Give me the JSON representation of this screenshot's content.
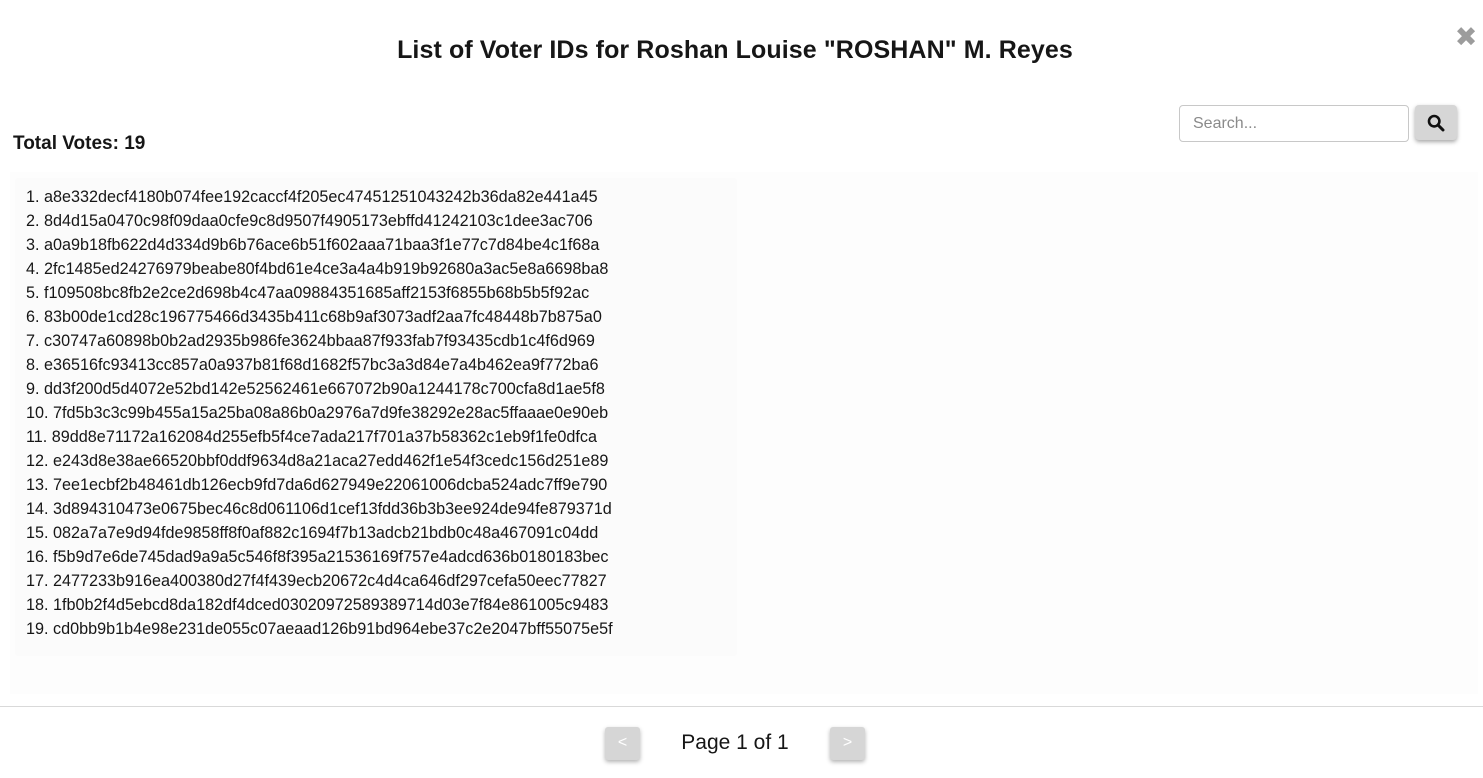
{
  "modal": {
    "title": "List of Voter IDs for Roshan Louise \"ROSHAN\" M. Reyes",
    "close_icon": "close-x-icon",
    "close_glyph": "✖"
  },
  "search": {
    "placeholder": "Search...",
    "value": "",
    "button_icon": "search-icon"
  },
  "summary": {
    "total_votes_label": "Total Votes: 19"
  },
  "voter_ids": [
    "1. a8e332decf4180b074fee192caccf4f205ec47451251043242b36da82e441a45",
    "2. 8d4d15a0470c98f09daa0cfe9c8d9507f4905173ebffd41242103c1dee3ac706",
    "3. a0a9b18fb622d4d334d9b6b76ace6b51f602aaa71baa3f1e77c7d84be4c1f68a",
    "4. 2fc1485ed24276979beabe80f4bd61e4ce3a4a4b919b92680a3ac5e8a6698ba8",
    "5. f109508bc8fb2e2ce2d698b4c47aa09884351685aff2153f6855b68b5b5f92ac",
    "6. 83b00de1cd28c196775466d3435b411c68b9af3073adf2aa7fc48448b7b875a0",
    "7. c30747a60898b0b2ad2935b986fe3624bbaa87f933fab7f93435cdb1c4f6d969",
    "8. e36516fc93413cc857a0a937b81f68d1682f57bc3a3d84e7a4b462ea9f772ba6",
    "9. dd3f200d5d4072e52bd142e52562461e667072b90a1244178c700cfa8d1ae5f8",
    "10. 7fd5b3c3c99b455a15a25ba08a86b0a2976a7d9fe38292e28ac5ffaaae0e90eb",
    "11. 89dd8e71172a162084d255efb5f4ce7ada217f701a37b58362c1eb9f1fe0dfca",
    "12. e243d8e38ae66520bbf0ddf9634d8a21aca27edd462f1e54f3cedc156d251e89",
    "13. 7ee1ecbf2b48461db126ecb9fd7da6d627949e22061006dcba524adc7ff9e790",
    "14. 3d894310473e0675bec46c8d061106d1cef13fdd36b3b3ee924de94fe879371d",
    "15. 082a7a7e9d94fde9858ff8f0af882c1694f7b13adcb21bdb0c48a467091c04dd",
    "16. f5b9d7e6de745dad9a9a5c546f8f395a21536169f757e4adcd636b0180183bec",
    "17. 2477233b916ea400380d27f4f439ecb20672c4d4ca646df297cefa50eec77827",
    "18. 1fb0b2f4d5ebcd8da182df4dced03020972589389714d03e7f84e861005c9483",
    "19. cd0bb9b1b4e98e231de055c07aeaad126b91bd964ebe37c2e2047bff55075e5f"
  ],
  "pagination": {
    "prev_label": "<",
    "next_label": ">",
    "page_label": "Page 1 of 1",
    "current_page": 1,
    "total_pages": 1
  },
  "colors": {
    "button_gray": "#d6d6d6",
    "close_gray": "#9c9c9c",
    "text": "#161616"
  }
}
